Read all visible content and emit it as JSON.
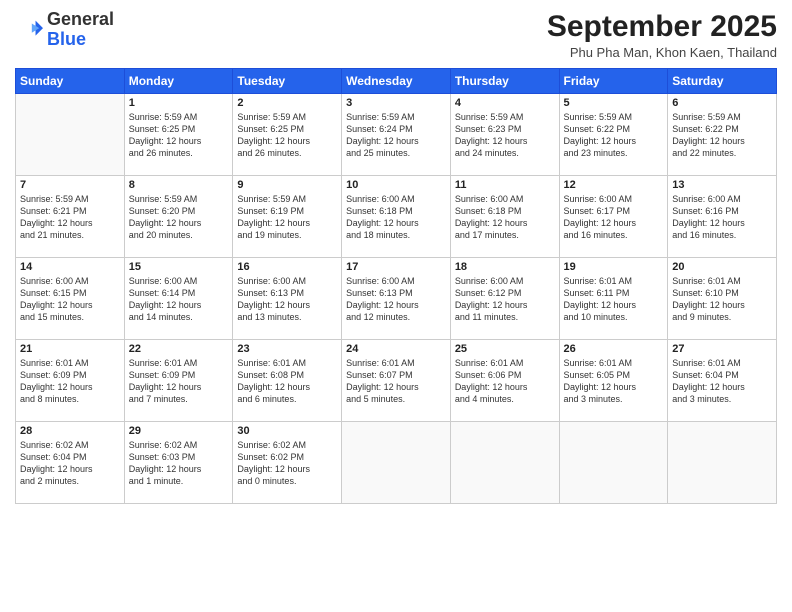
{
  "header": {
    "logo_line1": "General",
    "logo_line2": "Blue",
    "month_title": "September 2025",
    "location": "Phu Pha Man, Khon Kaen, Thailand"
  },
  "weekdays": [
    "Sunday",
    "Monday",
    "Tuesday",
    "Wednesday",
    "Thursday",
    "Friday",
    "Saturday"
  ],
  "weeks": [
    [
      {
        "day": "",
        "info": ""
      },
      {
        "day": "1",
        "info": "Sunrise: 5:59 AM\nSunset: 6:25 PM\nDaylight: 12 hours\nand 26 minutes."
      },
      {
        "day": "2",
        "info": "Sunrise: 5:59 AM\nSunset: 6:25 PM\nDaylight: 12 hours\nand 26 minutes."
      },
      {
        "day": "3",
        "info": "Sunrise: 5:59 AM\nSunset: 6:24 PM\nDaylight: 12 hours\nand 25 minutes."
      },
      {
        "day": "4",
        "info": "Sunrise: 5:59 AM\nSunset: 6:23 PM\nDaylight: 12 hours\nand 24 minutes."
      },
      {
        "day": "5",
        "info": "Sunrise: 5:59 AM\nSunset: 6:22 PM\nDaylight: 12 hours\nand 23 minutes."
      },
      {
        "day": "6",
        "info": "Sunrise: 5:59 AM\nSunset: 6:22 PM\nDaylight: 12 hours\nand 22 minutes."
      }
    ],
    [
      {
        "day": "7",
        "info": "Sunrise: 5:59 AM\nSunset: 6:21 PM\nDaylight: 12 hours\nand 21 minutes."
      },
      {
        "day": "8",
        "info": "Sunrise: 5:59 AM\nSunset: 6:20 PM\nDaylight: 12 hours\nand 20 minutes."
      },
      {
        "day": "9",
        "info": "Sunrise: 5:59 AM\nSunset: 6:19 PM\nDaylight: 12 hours\nand 19 minutes."
      },
      {
        "day": "10",
        "info": "Sunrise: 6:00 AM\nSunset: 6:18 PM\nDaylight: 12 hours\nand 18 minutes."
      },
      {
        "day": "11",
        "info": "Sunrise: 6:00 AM\nSunset: 6:18 PM\nDaylight: 12 hours\nand 17 minutes."
      },
      {
        "day": "12",
        "info": "Sunrise: 6:00 AM\nSunset: 6:17 PM\nDaylight: 12 hours\nand 16 minutes."
      },
      {
        "day": "13",
        "info": "Sunrise: 6:00 AM\nSunset: 6:16 PM\nDaylight: 12 hours\nand 16 minutes."
      }
    ],
    [
      {
        "day": "14",
        "info": "Sunrise: 6:00 AM\nSunset: 6:15 PM\nDaylight: 12 hours\nand 15 minutes."
      },
      {
        "day": "15",
        "info": "Sunrise: 6:00 AM\nSunset: 6:14 PM\nDaylight: 12 hours\nand 14 minutes."
      },
      {
        "day": "16",
        "info": "Sunrise: 6:00 AM\nSunset: 6:13 PM\nDaylight: 12 hours\nand 13 minutes."
      },
      {
        "day": "17",
        "info": "Sunrise: 6:00 AM\nSunset: 6:13 PM\nDaylight: 12 hours\nand 12 minutes."
      },
      {
        "day": "18",
        "info": "Sunrise: 6:00 AM\nSunset: 6:12 PM\nDaylight: 12 hours\nand 11 minutes."
      },
      {
        "day": "19",
        "info": "Sunrise: 6:01 AM\nSunset: 6:11 PM\nDaylight: 12 hours\nand 10 minutes."
      },
      {
        "day": "20",
        "info": "Sunrise: 6:01 AM\nSunset: 6:10 PM\nDaylight: 12 hours\nand 9 minutes."
      }
    ],
    [
      {
        "day": "21",
        "info": "Sunrise: 6:01 AM\nSunset: 6:09 PM\nDaylight: 12 hours\nand 8 minutes."
      },
      {
        "day": "22",
        "info": "Sunrise: 6:01 AM\nSunset: 6:09 PM\nDaylight: 12 hours\nand 7 minutes."
      },
      {
        "day": "23",
        "info": "Sunrise: 6:01 AM\nSunset: 6:08 PM\nDaylight: 12 hours\nand 6 minutes."
      },
      {
        "day": "24",
        "info": "Sunrise: 6:01 AM\nSunset: 6:07 PM\nDaylight: 12 hours\nand 5 minutes."
      },
      {
        "day": "25",
        "info": "Sunrise: 6:01 AM\nSunset: 6:06 PM\nDaylight: 12 hours\nand 4 minutes."
      },
      {
        "day": "26",
        "info": "Sunrise: 6:01 AM\nSunset: 6:05 PM\nDaylight: 12 hours\nand 3 minutes."
      },
      {
        "day": "27",
        "info": "Sunrise: 6:01 AM\nSunset: 6:04 PM\nDaylight: 12 hours\nand 3 minutes."
      }
    ],
    [
      {
        "day": "28",
        "info": "Sunrise: 6:02 AM\nSunset: 6:04 PM\nDaylight: 12 hours\nand 2 minutes."
      },
      {
        "day": "29",
        "info": "Sunrise: 6:02 AM\nSunset: 6:03 PM\nDaylight: 12 hours\nand 1 minute."
      },
      {
        "day": "30",
        "info": "Sunrise: 6:02 AM\nSunset: 6:02 PM\nDaylight: 12 hours\nand 0 minutes."
      },
      {
        "day": "",
        "info": ""
      },
      {
        "day": "",
        "info": ""
      },
      {
        "day": "",
        "info": ""
      },
      {
        "day": "",
        "info": ""
      }
    ]
  ]
}
